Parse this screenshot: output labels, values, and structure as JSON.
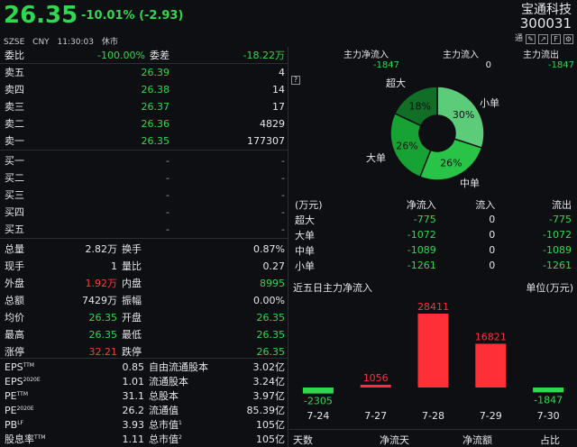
{
  "header": {
    "price": "26.35",
    "change": "-10.01% (-2.93)",
    "exchange": "SZSE",
    "currency": "CNY",
    "time": "11:30:03",
    "status": "休市",
    "stock_name": "宝通科技",
    "stock_code": "300031",
    "icons": [
      "通",
      "edit-icon",
      "export-icon",
      "f10-icon",
      "gear-icon"
    ],
    "icon_labels": {
      "tong": "通",
      "f10": "F"
    }
  },
  "weibi": {
    "label": "委比",
    "value": "-100.00%",
    "diff_label": "委差",
    "diff_value": "-18.22万"
  },
  "asks": [
    {
      "label": "卖五",
      "price": "26.39",
      "vol": "4"
    },
    {
      "label": "卖四",
      "price": "26.38",
      "vol": "14"
    },
    {
      "label": "卖三",
      "price": "26.37",
      "vol": "17"
    },
    {
      "label": "卖二",
      "price": "26.36",
      "vol": "4829"
    },
    {
      "label": "卖一",
      "price": "26.35",
      "vol": "177307"
    }
  ],
  "bids": [
    {
      "label": "买一",
      "price": "-",
      "vol": "-"
    },
    {
      "label": "买二",
      "price": "-",
      "vol": "-"
    },
    {
      "label": "买三",
      "price": "-",
      "vol": "-"
    },
    {
      "label": "买四",
      "price": "-",
      "vol": "-"
    },
    {
      "label": "买五",
      "price": "-",
      "vol": "-"
    }
  ],
  "stats": [
    {
      "l1": "总量",
      "v1": "2.82万",
      "l2": "换手",
      "v2": "0.87%"
    },
    {
      "l1": "现手",
      "v1": "1",
      "l2": "量比",
      "v2": "0.27"
    },
    {
      "l1": "外盘",
      "v1": "1.92万",
      "l2": "内盘",
      "v2": "8995"
    },
    {
      "l1": "总额",
      "v1": "7429万",
      "l2": "振幅",
      "v2": "0.00%"
    },
    {
      "l1": "均价",
      "v1": "26.35",
      "l2": "开盘",
      "v2": "26.35"
    },
    {
      "l1": "最高",
      "v1": "26.35",
      "l2": "最低",
      "v2": "26.35"
    },
    {
      "l1": "涨停",
      "v1": "32.21",
      "l2": "跌停",
      "v2": "26.35"
    }
  ],
  "fundamentals": [
    {
      "l1": "EPS",
      "s1": "TTM",
      "v1": "0.85",
      "l2": "自由流通股本",
      "s2": "",
      "v2": "3.02亿"
    },
    {
      "l1": "EPS",
      "s1": "2020E",
      "v1": "1.01",
      "l2": "流通股本",
      "s2": "",
      "v2": "3.24亿"
    },
    {
      "l1": "PE",
      "s1": "TTM",
      "v1": "31.1",
      "l2": "总股本",
      "s2": "",
      "v2": "3.97亿"
    },
    {
      "l1": "PE",
      "s1": "2020E",
      "v1": "26.2",
      "l2": "流通值",
      "s2": "",
      "v2": "85.39亿"
    },
    {
      "l1": "PB",
      "s1": "LF",
      "v1": "3.93",
      "l2": "总市值",
      "s2": "1",
      "v2": "105亿"
    },
    {
      "l1": "股息率",
      "s1": "TTM",
      "v1": "1.11",
      "l2": "总市值",
      "s2": "2",
      "v2": "105亿"
    }
  ],
  "mainflow": {
    "net_label": "主力净流入",
    "net_value": "-1847",
    "in_label": "主力流入",
    "in_value": "0",
    "out_label": "主力流出",
    "out_value": "-1847",
    "help": "?"
  },
  "donut": {
    "slices": [
      {
        "name": "小单",
        "pct": 30,
        "label": "30%",
        "color": "#5ccb7a"
      },
      {
        "name": "中单",
        "pct": 26,
        "label": "26%",
        "color": "#29c447"
      },
      {
        "name": "大单",
        "pct": 26,
        "label": "26%",
        "color": "#17a333"
      },
      {
        "name": "超大",
        "pct": 18,
        "label": "18%",
        "color": "#106e26"
      }
    ]
  },
  "flow_table": {
    "headers": [
      "(万元)",
      "净流入",
      "流入",
      "流出"
    ],
    "rows": [
      [
        "超大",
        "-775",
        "0",
        "-775"
      ],
      [
        "大单",
        "-1072",
        "0",
        "-1072"
      ],
      [
        "中单",
        "-1089",
        "0",
        "-1089"
      ],
      [
        "小单",
        "-1261",
        "0",
        "-1261"
      ]
    ]
  },
  "five_day": {
    "title": "近五日主力净流入",
    "unit": "单位(万元)"
  },
  "chart_data": {
    "type": "bar",
    "categories": [
      "7-24",
      "7-27",
      "7-28",
      "7-29",
      "7-30"
    ],
    "values": [
      -2305,
      1056,
      28411,
      16821,
      -1847
    ],
    "labels": [
      "-2305",
      "1056",
      "28411",
      "16821",
      "-1847"
    ],
    "colors": {
      "positive": "#ff3037",
      "negative": "#2ed84f"
    }
  },
  "bottom": {
    "days": "天数",
    "net_day": "净流天",
    "net_amount": "净流额",
    "ratio": "占比"
  }
}
